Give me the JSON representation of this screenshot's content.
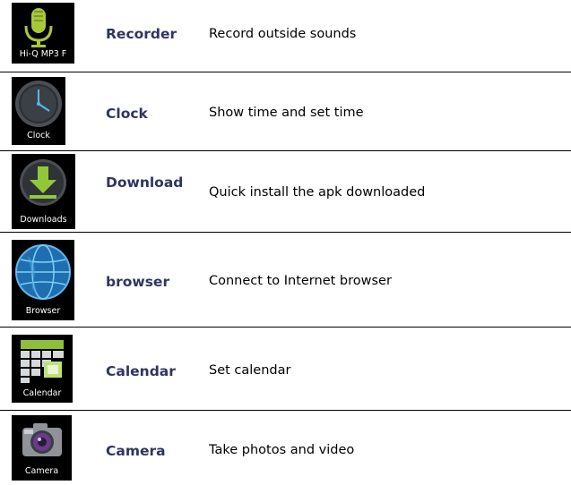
{
  "apps": [
    {
      "icon": "microphone-icon",
      "caption": "Hi-Q MP3 F",
      "name": "Recorder",
      "description": "Record outside sounds"
    },
    {
      "icon": "clock-icon",
      "caption": "Clock",
      "name": "Clock",
      "description": "Show time and set time"
    },
    {
      "icon": "download-icon",
      "caption": "Downloads",
      "name": "Download",
      "description": "Quick install the apk downloaded"
    },
    {
      "icon": "globe-icon",
      "caption": "Browser",
      "name": "browser",
      "description": "Connect to Internet browser"
    },
    {
      "icon": "calendar-icon",
      "caption": "Calendar",
      "name": "Calendar",
      "description": "Set calendar"
    },
    {
      "icon": "camera-icon",
      "caption": "Camera",
      "name": "Camera",
      "description": "Take photos and video"
    }
  ],
  "colors": {
    "app_name": "#2e3562",
    "text": "#000000",
    "divider": "#000000",
    "icon_bg": "#000000"
  }
}
